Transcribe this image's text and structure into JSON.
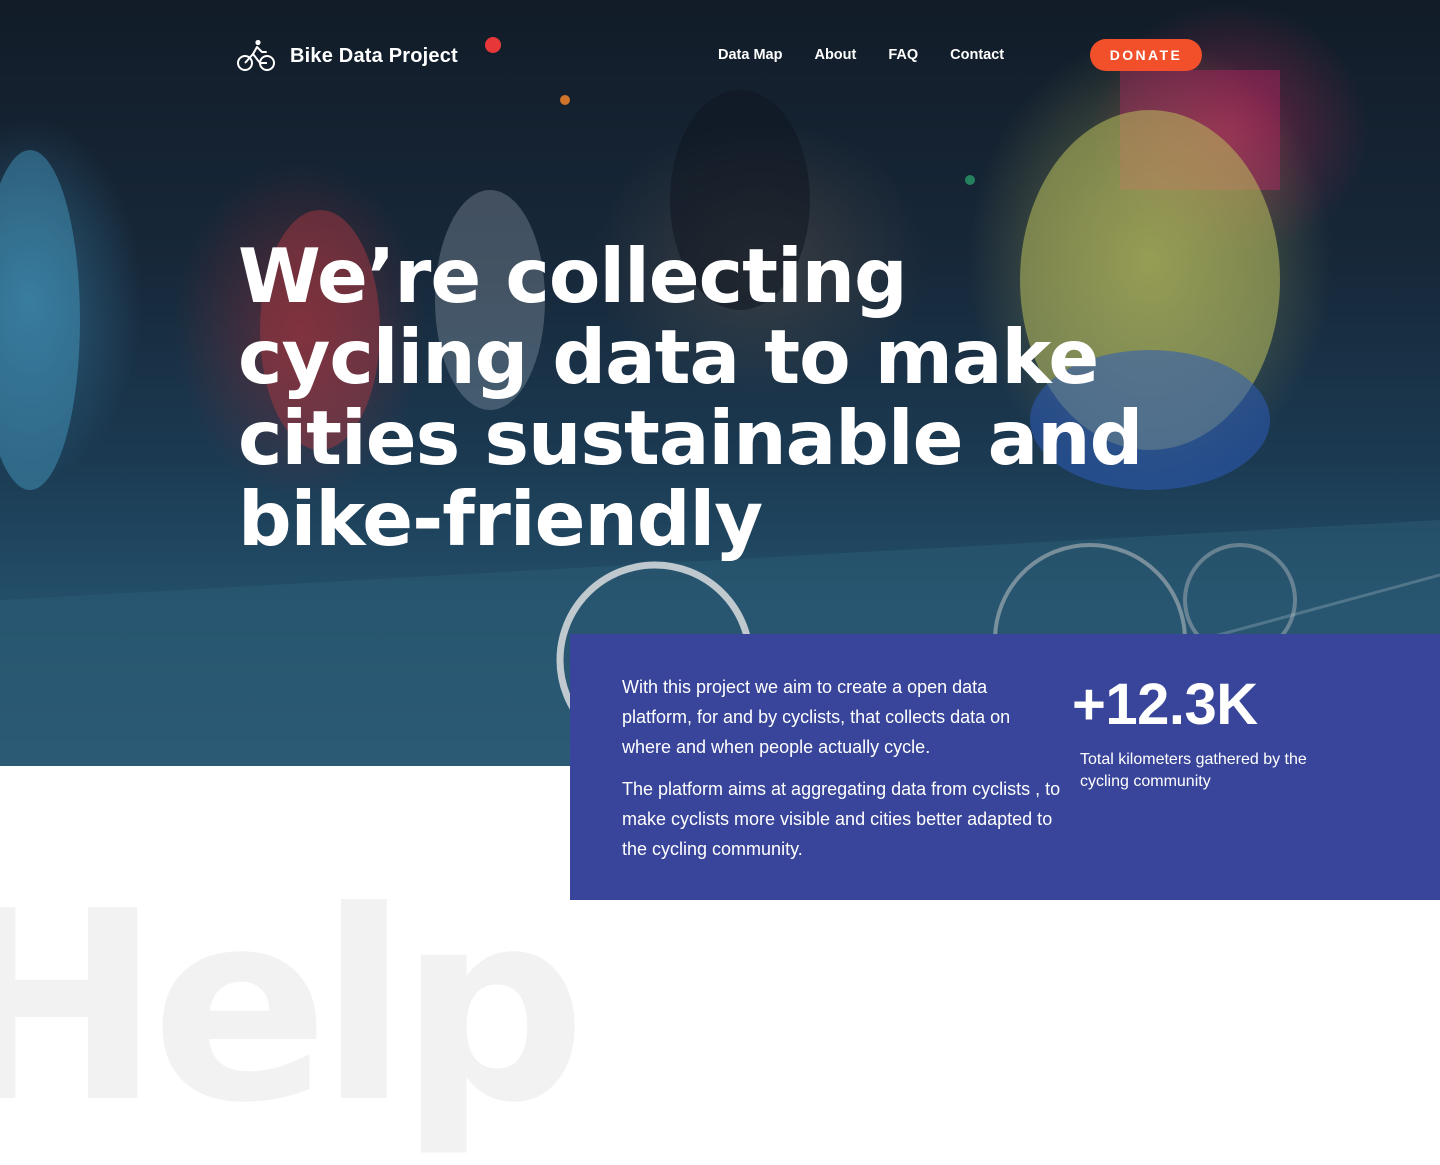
{
  "brand": {
    "name": "Bike Data Project",
    "icon": "cyclist-icon"
  },
  "nav": {
    "items": [
      {
        "label": "Data Map"
      },
      {
        "label": "About"
      },
      {
        "label": "FAQ"
      },
      {
        "label": "Contact"
      }
    ],
    "donate_label": "DONATE"
  },
  "hero": {
    "headline": "We’re collecting cycling data to make cities sustainable and bike-friendly"
  },
  "info": {
    "paragraphs": [
      "With this project we aim to create a open data platform, for and by cyclists, that collects data on where and when people actually cycle.",
      "The platform aims at aggregating data from cyclists , to make cyclists more visible and cities better adapted to the cycling community."
    ],
    "stat_value": "+12.3K",
    "stat_label": "Total kilometers gathered by the cycling community"
  },
  "background_word": "Help",
  "colors": {
    "accent": "#f2502a",
    "panel": "#38459a",
    "ghost_text": "#f2f2f2",
    "text_light": "#ffffff"
  }
}
